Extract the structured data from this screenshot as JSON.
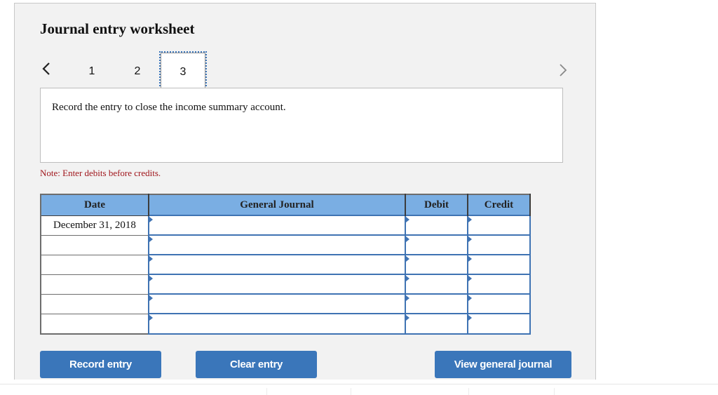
{
  "worksheet": {
    "title": "Journal entry worksheet",
    "nav": {
      "prev_icon": "chevron-left-icon",
      "next_icon": "chevron-right-icon",
      "tabs": [
        {
          "label": "1",
          "active": false
        },
        {
          "label": "2",
          "active": false
        },
        {
          "label": "3",
          "active": true
        }
      ]
    },
    "instruction": "Record the entry to close the income summary account.",
    "note": "Note: Enter debits before credits.",
    "table": {
      "headers": [
        "Date",
        "General Journal",
        "Debit",
        "Credit"
      ],
      "rows": [
        {
          "date": "December 31, 2018",
          "account": "",
          "debit": "",
          "credit": ""
        },
        {
          "date": "",
          "account": "",
          "debit": "",
          "credit": ""
        },
        {
          "date": "",
          "account": "",
          "debit": "",
          "credit": ""
        },
        {
          "date": "",
          "account": "",
          "debit": "",
          "credit": ""
        },
        {
          "date": "",
          "account": "",
          "debit": "",
          "credit": ""
        },
        {
          "date": "",
          "account": "",
          "debit": "",
          "credit": ""
        }
      ]
    },
    "buttons": {
      "record": "Record entry",
      "clear": "Clear entry",
      "view": "View general journal"
    },
    "colors": {
      "header_bg": "#7aaee3",
      "button_bg": "#3a76ba",
      "input_border": "#3f73b3",
      "note_text": "#a0161c",
      "focus_outline": "#3a74b8"
    }
  }
}
